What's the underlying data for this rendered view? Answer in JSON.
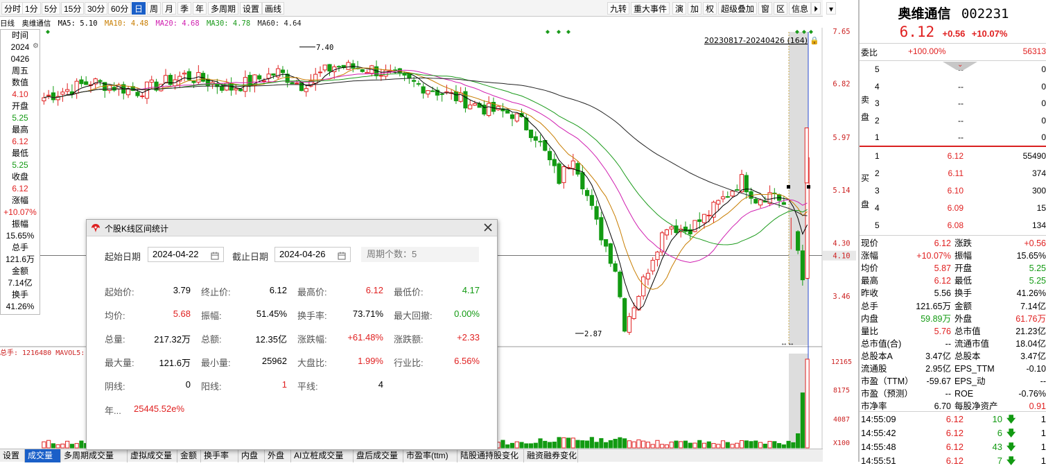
{
  "toolbar": {
    "periods": [
      "分时",
      "1分",
      "5分",
      "15分",
      "30分",
      "60分",
      "日",
      "周",
      "月",
      "季",
      "年",
      "多周期",
      "设置",
      "画线"
    ],
    "active_period": "日",
    "right_items": [
      "九转",
      "重大事件",
      "演",
      "加",
      "权",
      "超级叠加",
      "窗",
      "区",
      "信息"
    ]
  },
  "legend": {
    "period": "日线",
    "stock": "奥维通信",
    "ma5": "MA5: 5.10",
    "ma10": "MA10: 4.48",
    "ma20": "MA20: 4.68",
    "ma30": "MA30: 4.78",
    "ma60": "MA60: 4.64",
    "colors": {
      "ma5": "#000000",
      "ma10": "#c87d00",
      "ma20": "#d01fb0",
      "ma30": "#1a9a1a",
      "ma60": "#222222"
    }
  },
  "info_panel": {
    "items": [
      {
        "text": "时间",
        "color": "#000000"
      },
      {
        "text": "2024",
        "color": "#000000"
      },
      {
        "text": "0426",
        "color": "#000000"
      },
      {
        "text": "周五",
        "color": "#000000"
      },
      {
        "text": "数值",
        "color": "#000000"
      },
      {
        "text": "4.10",
        "color": "#e02020"
      },
      {
        "text": "开盘",
        "color": "#000000"
      },
      {
        "text": "5.25",
        "color": "#129a12"
      },
      {
        "text": "最高",
        "color": "#000000"
      },
      {
        "text": "6.12",
        "color": "#e02020"
      },
      {
        "text": "最低",
        "color": "#000000"
      },
      {
        "text": "5.25",
        "color": "#129a12"
      },
      {
        "text": "收盘",
        "color": "#000000"
      },
      {
        "text": "6.12",
        "color": "#e02020"
      },
      {
        "text": "涨幅",
        "color": "#000000"
      },
      {
        "text": "+10.07%",
        "color": "#e02020"
      },
      {
        "text": "振幅",
        "color": "#000000"
      },
      {
        "text": "15.65%",
        "color": "#000000"
      },
      {
        "text": "总手",
        "color": "#000000"
      },
      {
        "text": "121.6万",
        "color": "#000000"
      },
      {
        "text": "金额",
        "color": "#000000"
      },
      {
        "text": "7.14亿",
        "color": "#000000"
      },
      {
        "text": "换手",
        "color": "#000000"
      },
      {
        "text": "41.26%",
        "color": "#000000"
      }
    ]
  },
  "chart_labels": {
    "range": "20230817-20240426 (164)",
    "high_mark": "7.40",
    "low_mark": "2.87",
    "price_ticks": [
      "7.65",
      "6.82",
      "5.97",
      "5.14",
      "4.30",
      "4.10",
      "3.46"
    ],
    "volume_ticks": [
      "12165",
      "8175",
      "4087",
      "X100"
    ],
    "volume_legend": "总手: 1216480  MAVOL5: "
  },
  "bottom_tabs": [
    "设置",
    "成交量",
    "多周期成交量",
    "虚拟成交量",
    "金额",
    "换手率",
    "内盘",
    "外盘",
    "AI立桩成交量",
    "盘后成交量",
    "市盈率(ttm)",
    "陆股通持股变化",
    "融资融券变化"
  ],
  "active_bottom_tab": "成交量",
  "dialog": {
    "title": "个股K线区间统计",
    "start_label": "起始日期",
    "start_date": "2024-04-22",
    "end_label": "截止日期",
    "end_date": "2024-04-26",
    "period_count": "周期个数：5",
    "stats": [
      [
        {
          "label": "起始价:",
          "value": "3.79",
          "color": "#000000"
        },
        {
          "label": "终止价:",
          "value": "6.12",
          "color": "#000000"
        },
        {
          "label": "最高价:",
          "value": "6.12",
          "color": "#e02020"
        },
        {
          "label": "最低价:",
          "value": "4.17",
          "color": "#129a12"
        }
      ],
      [
        {
          "label": "均价:",
          "value": "5.68",
          "color": "#e02020"
        },
        {
          "label": "振幅:",
          "value": "51.45%",
          "color": "#000000"
        },
        {
          "label": "换手率:",
          "value": "73.71%",
          "color": "#000000"
        },
        {
          "label": "最大回撤:",
          "value": "0.00%",
          "color": "#129a12"
        }
      ],
      [
        {
          "label": "总量:",
          "value": "217.32万",
          "color": "#000000"
        },
        {
          "label": "总额:",
          "value": "12.35亿",
          "color": "#000000"
        },
        {
          "label": "涨跌幅:",
          "value": "+61.48%",
          "color": "#e02020"
        },
        {
          "label": "涨跌额:",
          "value": "+2.33",
          "color": "#e02020"
        }
      ],
      [
        {
          "label": "最大量:",
          "value": "121.6万",
          "color": "#000000"
        },
        {
          "label": "最小量:",
          "value": "25962",
          "color": "#000000"
        },
        {
          "label": "大盘比:",
          "value": "1.99%",
          "color": "#e02020"
        },
        {
          "label": "行业比:",
          "value": "6.56%",
          "color": "#e02020"
        }
      ],
      [
        {
          "label": "阴线:",
          "value": "0",
          "color": "#000000"
        },
        {
          "label": "阳线:",
          "value": "1",
          "color": "#e02020"
        },
        {
          "label": "平线:",
          "value": "4",
          "color": "#000000"
        }
      ]
    ],
    "annual_label": "年...",
    "annual_value": "25445.52e%"
  },
  "quote": {
    "name": "奥维通信",
    "code": "002231",
    "price": "6.12",
    "change": "+0.56",
    "pct": "+10.07%",
    "weibi_label": "委比",
    "weibi": "+100.00%",
    "weicha": "56313",
    "sell_label": "卖盘",
    "buy_label": "买盘",
    "sells": [
      {
        "level": "5",
        "price": "--",
        "vol": "0"
      },
      {
        "level": "4",
        "price": "--",
        "vol": "0"
      },
      {
        "level": "3",
        "price": "--",
        "vol": "0"
      },
      {
        "level": "2",
        "price": "--",
        "vol": "0"
      },
      {
        "level": "1",
        "price": "--",
        "vol": "0"
      }
    ],
    "buys": [
      {
        "level": "1",
        "price": "6.12",
        "vol": "55490"
      },
      {
        "level": "2",
        "price": "6.11",
        "vol": "374"
      },
      {
        "level": "3",
        "price": "6.10",
        "vol": "300"
      },
      {
        "level": "4",
        "price": "6.09",
        "vol": "15"
      },
      {
        "level": "5",
        "price": "6.08",
        "vol": "134"
      }
    ],
    "fields": [
      [
        {
          "label": "现价",
          "value": "6.12",
          "color": "#e02020"
        },
        {
          "label": "涨跌",
          "value": "+0.56",
          "color": "#e02020"
        }
      ],
      [
        {
          "label": "涨幅",
          "value": "+10.07%",
          "color": "#e02020"
        },
        {
          "label": "振幅",
          "value": "15.65%",
          "color": "#000000"
        }
      ],
      [
        {
          "label": "均价",
          "value": "5.87",
          "color": "#e02020"
        },
        {
          "label": "开盘",
          "value": "5.25",
          "color": "#129a12"
        }
      ],
      [
        {
          "label": "最高",
          "value": "6.12",
          "color": "#e02020"
        },
        {
          "label": "最低",
          "value": "5.25",
          "color": "#129a12"
        }
      ],
      [
        {
          "label": "昨收",
          "value": "5.56",
          "color": "#000000"
        },
        {
          "label": "换手",
          "value": "41.26%",
          "color": "#000000"
        }
      ],
      [
        {
          "label": "总手",
          "value": "121.65万",
          "color": "#000000"
        },
        {
          "label": "金额",
          "value": "7.14亿",
          "color": "#000000"
        }
      ],
      [
        {
          "label": "内盘",
          "value": "59.89万",
          "color": "#129a12"
        },
        {
          "label": "外盘",
          "value": "61.76万",
          "color": "#e02020"
        }
      ],
      [
        {
          "label": "量比",
          "value": "5.76",
          "color": "#e02020"
        },
        {
          "label": "总市值",
          "value": "21.23亿",
          "color": "#000000"
        }
      ],
      [
        {
          "label": "总市值(合)",
          "value": "--",
          "color": "#000000"
        },
        {
          "label": "流通市值",
          "value": "18.04亿",
          "color": "#000000"
        }
      ],
      [
        {
          "label": "总股本A",
          "value": "3.47亿",
          "color": "#000000"
        },
        {
          "label": "总股本",
          "value": "3.47亿",
          "color": "#000000"
        }
      ],
      [
        {
          "label": "流通股",
          "value": "2.95亿",
          "color": "#000000"
        },
        {
          "label": "EPS_TTM",
          "value": "-0.10",
          "color": "#000000"
        }
      ],
      [
        {
          "label": "市盈（TTM）",
          "value": "-59.67",
          "color": "#000000"
        },
        {
          "label": "EPS_动",
          "value": "--",
          "color": "#000000"
        }
      ],
      [
        {
          "label": "市盈（预测）",
          "value": "--",
          "color": "#000000"
        },
        {
          "label": "ROE",
          "value": "-0.76%",
          "color": "#000000"
        }
      ],
      [
        {
          "label": "市净率",
          "value": "6.70",
          "color": "#000000"
        },
        {
          "label": "每股净资产",
          "value": "0.91",
          "color": "#e02020"
        }
      ]
    ],
    "ticks": [
      {
        "time": "14:55:09",
        "price": "6.12",
        "vol": "10",
        "dir": "down",
        "n": "1"
      },
      {
        "time": "14:55:42",
        "price": "6.12",
        "vol": "6",
        "dir": "down",
        "n": "1"
      },
      {
        "time": "14:55:48",
        "price": "6.12",
        "vol": "43",
        "dir": "down",
        "n": "1"
      },
      {
        "time": "14:55:51",
        "price": "6.12",
        "vol": "7",
        "dir": "down",
        "n": "1"
      }
    ]
  }
}
